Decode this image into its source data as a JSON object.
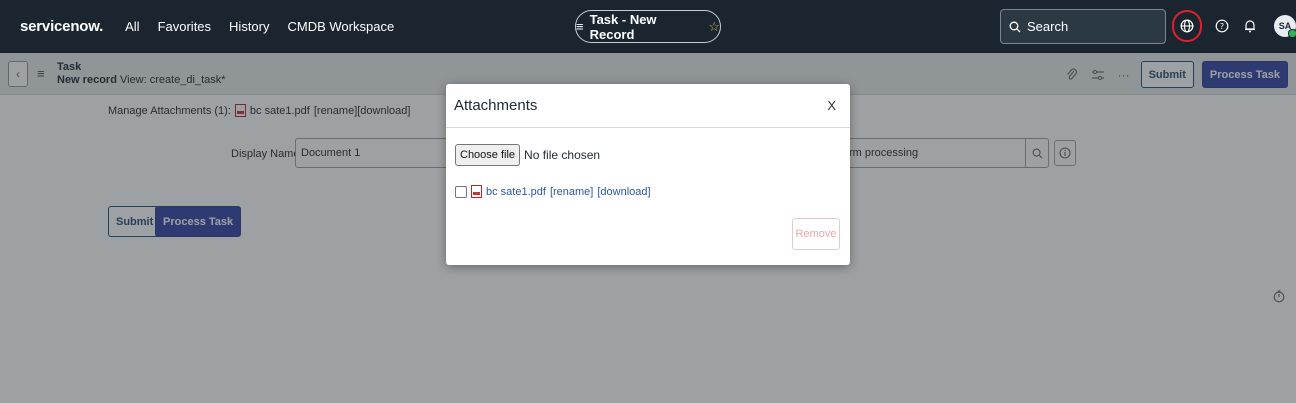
{
  "topnav": {
    "logo": "servicenow.",
    "links": [
      "All",
      "Favorites",
      "History",
      "CMDB Workspace"
    ],
    "context_pill": "Task - New Record",
    "search_placeholder": "Search",
    "avatar_initials": "SA",
    "icons": [
      "menu-icon",
      "star-icon",
      "search-icon",
      "globe-icon",
      "help-icon",
      "bell-icon"
    ]
  },
  "formhead": {
    "table": "Task",
    "record_label": "New record",
    "view_label": "View: create_di_task*",
    "submit_label": "Submit",
    "process_label": "Process Task"
  },
  "formbody": {
    "manage_attachments": "Manage Attachments (1):",
    "attachment_name": "bc sate1.pdf",
    "attachment_actions": "[rename][download]",
    "display_name_label": "Display Name",
    "display_name_value": "Document 1",
    "reference_value": "rm processing",
    "submit_label": "Submit",
    "process_label": "Process Task"
  },
  "modal": {
    "title": "Attachments",
    "close_label": "X",
    "choose_file_label": "Choose file",
    "no_file_text": "No file chosen",
    "file_name": "bc sate1.pdf",
    "rename_label": "[rename]",
    "download_label": "[download]",
    "remove_label": "Remove"
  },
  "colors": {
    "nav_bg": "#1a2530",
    "primary_button": "#3446a8",
    "highlight_ring": "#e0202a",
    "link": "#2d57a5"
  }
}
